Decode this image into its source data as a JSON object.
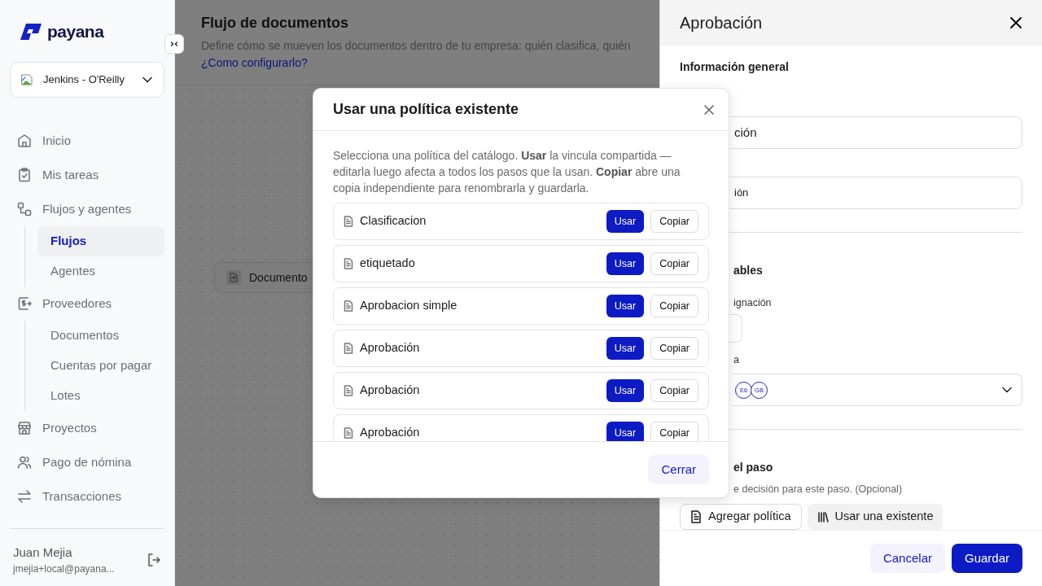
{
  "sidebar": {
    "logo": "payana",
    "workspace": "Jenkins - O'Reilly",
    "nav": [
      {
        "label": "Inicio",
        "selected": false
      },
      {
        "label": "Mis tareas",
        "selected": false
      },
      {
        "label": "Flujos y agentes",
        "selected": false,
        "children": [
          {
            "label": "Flujos",
            "selected": true
          },
          {
            "label": "Agentes",
            "selected": false
          }
        ]
      },
      {
        "label": "Proveedores",
        "selected": false,
        "children": [
          {
            "label": "Documentos",
            "selected": false
          },
          {
            "label": "Cuentas por pagar",
            "selected": false
          },
          {
            "label": "Lotes",
            "selected": false
          }
        ]
      },
      {
        "label": "Proyectos",
        "selected": false
      },
      {
        "label": "Pago de nómina",
        "selected": false
      },
      {
        "label": "Transacciones",
        "selected": false
      }
    ],
    "user": {
      "name": "Juan Mejia",
      "email": "jmejia+local@payana..."
    }
  },
  "main": {
    "title": "Flujo de documentos",
    "description": "Define cómo se mueven los documentos dentro de tu empresa: quién clasifica, quién",
    "help_link": "¿Como configurarlo?",
    "nodes": [
      {
        "label": "Documento"
      }
    ]
  },
  "panel": {
    "title": "Aprobación",
    "general_heading": "Información general",
    "field_1_value": "ción",
    "field_2_value": "ión",
    "heading_2": "ables",
    "label_1": "ignación",
    "label_2": "a",
    "approvers": [
      {
        "initials": "E6"
      },
      {
        "initials": "GB"
      }
    ],
    "heading_3": "el paso",
    "hint_3": "e decisión para este paso. (Opcional)",
    "add_policy_button": "Agregar política",
    "use_existing_button": "Usar una existente",
    "cancel_button": "Cancelar",
    "save_button": "Guardar"
  },
  "modal": {
    "title": "Usar una política existente",
    "description": "Selecciona una política del catálogo. **Usar** la vincula compartida — editarla luego afecta a todos los pasos que la usan. **Copiar** abre una copia independiente para renombrarla y guardarla.",
    "policies": [
      {
        "name": "Clasificacion",
        "use_label": "Usar",
        "copy_label": "Copiar"
      },
      {
        "name": "etiquetado",
        "use_label": "Usar",
        "copy_label": "Copiar"
      },
      {
        "name": "Aprobacion simple",
        "use_label": "Usar",
        "copy_label": "Copiar"
      },
      {
        "name": "Aprobación",
        "use_label": "Usar",
        "copy_label": "Copiar"
      },
      {
        "name": "Aprobación",
        "use_label": "Usar",
        "copy_label": "Copiar"
      },
      {
        "name": "Aprobación",
        "use_label": "Usar",
        "copy_label": "Copiar"
      }
    ],
    "close_button": "Cerrar"
  }
}
